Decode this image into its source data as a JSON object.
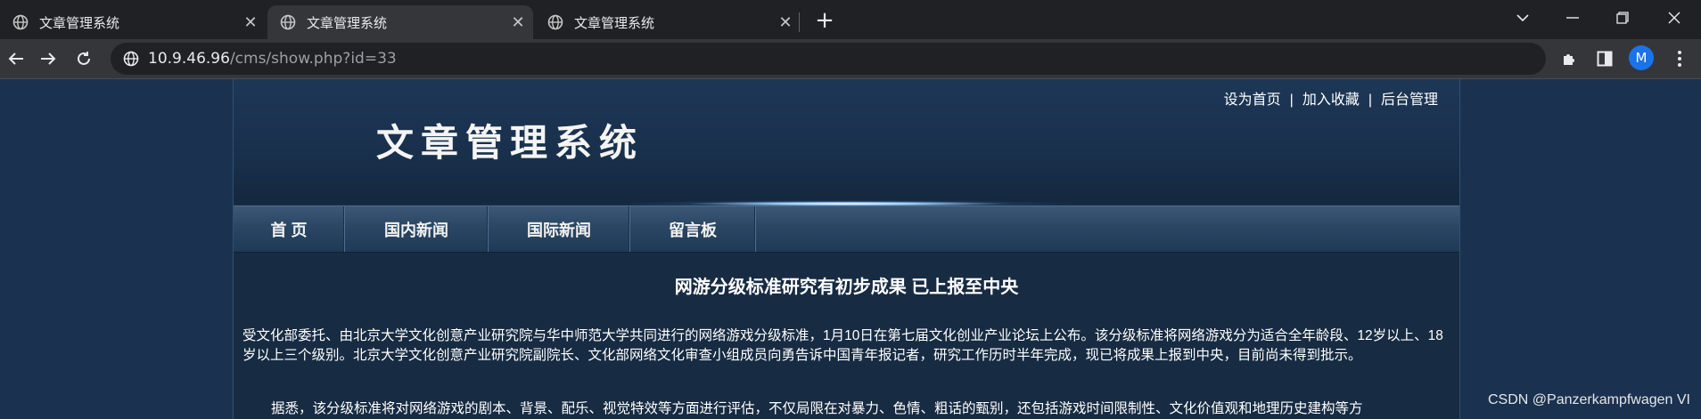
{
  "browser": {
    "tabs": [
      {
        "title": "文章管理系统"
      },
      {
        "title": "文章管理系统"
      },
      {
        "title": "文章管理系统"
      }
    ],
    "new_tab": "+",
    "address": {
      "host": "10.9.46.96",
      "path": "/cms/show.php?id=33"
    },
    "profile_initial": "M"
  },
  "site": {
    "logo_text": "文章管理系统",
    "top_links": [
      "设为首页",
      "加入收藏",
      "后台管理"
    ],
    "top_link_separator": "|",
    "nav": [
      "首 页",
      "国内新闻",
      "国际新闻",
      "留言板"
    ]
  },
  "article": {
    "title": "网游分级标准研究有初步成果 已上报至中央",
    "paragraphs": [
      "受文化部委托、由北京大学文化创意产业研究院与华中师范大学共同进行的网络游戏分级标准，1月10日在第七届文化创业产业论坛上公布。该分级标准将网络游戏分为适合全年龄段、12岁以上、18岁以上三个级别。北京大学文化创意产业研究院副院长、文化部网络文化审查小组成员向勇告诉中国青年报记者，研究工作历时半年完成，现已将成果上报到中央，目前尚未得到批示。",
      "据悉，该分级标准将对网络游戏的剧本、背景、配乐、视觉特效等方面进行评估，不仅局限在对暴力、色情、粗话的甄别，还包括游戏时间限制性、文化价值观和地理历史建构等方"
    ]
  },
  "watermark": "CSDN @Panzerkampfwagen VI"
}
